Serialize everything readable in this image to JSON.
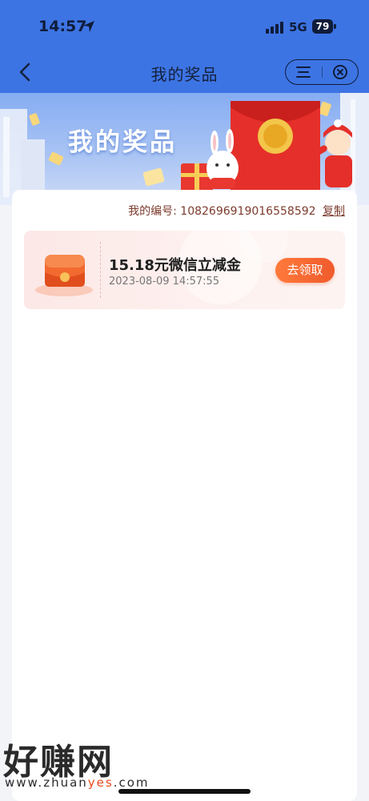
{
  "status": {
    "time": "14:57",
    "network": "5G",
    "battery": "79"
  },
  "nav": {
    "title": "我的奖品"
  },
  "banner": {
    "title": "我的奖品"
  },
  "prizes": {
    "id_label": "我的编号:",
    "id_value": "1082696919016558592",
    "copy_label": "复制",
    "items": [
      {
        "name": "15.18元微信立减金",
        "date": "2023-08-09 14:57:55",
        "action": "去领取"
      }
    ]
  },
  "watermark": {
    "main": "好赚网",
    "url_prefix": "www.zhuan",
    "url_highlight": "yes",
    "url_suffix": ".com"
  },
  "colors": {
    "nav_blue": "#3d74e3",
    "accent_orange": "#f05a2c",
    "id_brown": "#7c3b2d"
  }
}
